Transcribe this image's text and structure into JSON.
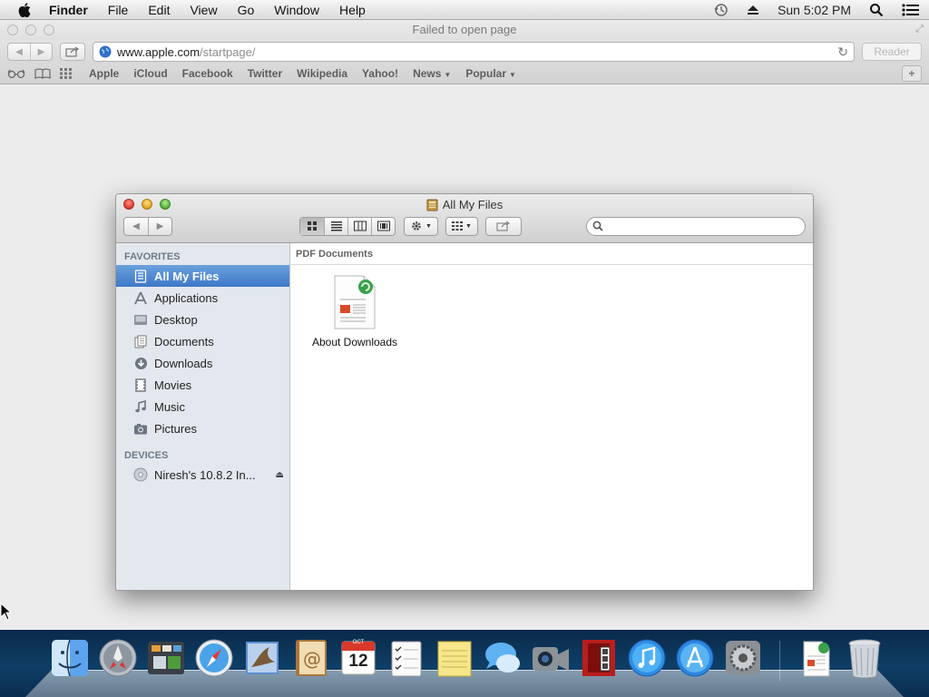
{
  "menubar": {
    "app_name": "Finder",
    "menus": [
      "File",
      "Edit",
      "View",
      "Go",
      "Window",
      "Help"
    ],
    "clock": "Sun 5:02 PM"
  },
  "safari": {
    "window_title": "Failed to open page",
    "address_host": "www.apple.com",
    "address_path": "/startpage/",
    "reader_label": "Reader",
    "bookmarks": [
      {
        "label": "Apple",
        "menu": false
      },
      {
        "label": "iCloud",
        "menu": false
      },
      {
        "label": "Facebook",
        "menu": false
      },
      {
        "label": "Twitter",
        "menu": false
      },
      {
        "label": "Wikipedia",
        "menu": false
      },
      {
        "label": "Yahoo!",
        "menu": false
      },
      {
        "label": "News",
        "menu": true
      },
      {
        "label": "Popular",
        "menu": true
      }
    ],
    "add_label": "+"
  },
  "finder": {
    "title": "All My Files",
    "search_placeholder": "",
    "sidebar": {
      "favorites_header": "FAVORITES",
      "favorites": [
        {
          "label": "All My Files",
          "icon": "all-files-icon",
          "selected": true
        },
        {
          "label": "Applications",
          "icon": "applications-icon",
          "selected": false
        },
        {
          "label": "Desktop",
          "icon": "desktop-icon",
          "selected": false
        },
        {
          "label": "Documents",
          "icon": "documents-icon",
          "selected": false
        },
        {
          "label": "Downloads",
          "icon": "downloads-icon",
          "selected": false
        },
        {
          "label": "Movies",
          "icon": "movies-icon",
          "selected": false
        },
        {
          "label": "Music",
          "icon": "music-icon",
          "selected": false
        },
        {
          "label": "Pictures",
          "icon": "pictures-icon",
          "selected": false
        }
      ],
      "devices_header": "DEVICES",
      "devices": [
        {
          "label": "Niresh's 10.8.2 In...",
          "icon": "disk-icon",
          "eject": true
        }
      ]
    },
    "content": {
      "group_header": "PDF Documents",
      "files": [
        {
          "label": "About Downloads",
          "icon": "pdf-document-icon"
        }
      ]
    }
  },
  "dock": {
    "apps": [
      "finder",
      "launchpad",
      "mission-control",
      "safari",
      "mail",
      "contacts",
      "calendar",
      "reminders",
      "notes",
      "messages",
      "facetime",
      "photo-booth",
      "itunes",
      "app-store",
      "system-preferences"
    ],
    "calendar_day": "12",
    "calendar_month": "OCT",
    "stack_items": [
      "downloads-stack",
      "trash"
    ]
  },
  "colors": {
    "selection": "#3f78c7",
    "sidebar_bg": "#e3e8ee",
    "dock_bg": "#0f3e66"
  }
}
